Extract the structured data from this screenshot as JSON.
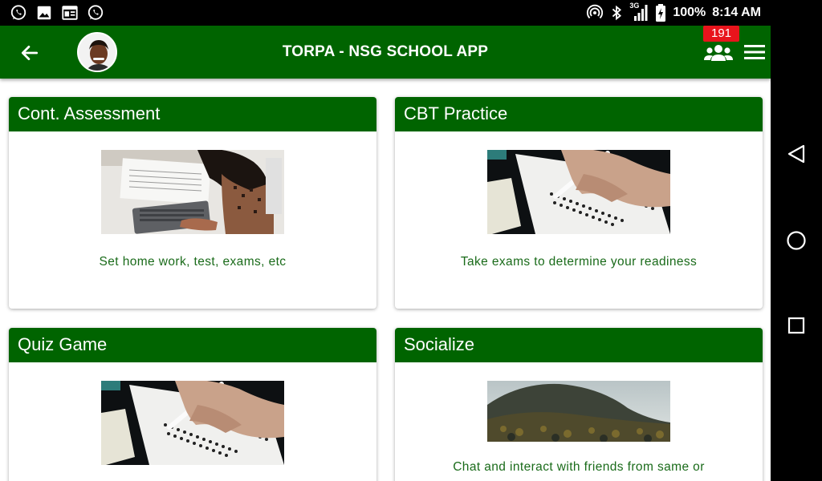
{
  "status_bar": {
    "battery": "100%",
    "time": "8:14 AM",
    "network": "3G",
    "left_icons": [
      "whatsapp-icon",
      "image-icon",
      "news-icon",
      "whatsapp-icon"
    ],
    "right_icons": [
      "hotspot-icon",
      "bluetooth-icon",
      "signal-icon",
      "battery-icon"
    ]
  },
  "app_bar": {
    "title": "TORPA - NSG SCHOOL APP",
    "notification_count": "191",
    "color": "#006400"
  },
  "cards": [
    {
      "title": "Cont. Assessment",
      "description": "Set home work, test, exams, etc",
      "image": "student-writing-laptop"
    },
    {
      "title": "CBT Practice",
      "description": "Take exams to determine your readiness",
      "image": "answer-sheet-pencil"
    },
    {
      "title": "Quiz Game",
      "description": "",
      "image": "answer-sheet-pencil"
    },
    {
      "title": "Socialize",
      "description": "Chat and interact with friends from same or",
      "image": "forest-hills"
    }
  ],
  "colors": {
    "primary": "#006400",
    "badge": "#e8141c",
    "desc_text": "#1a6b1a"
  }
}
